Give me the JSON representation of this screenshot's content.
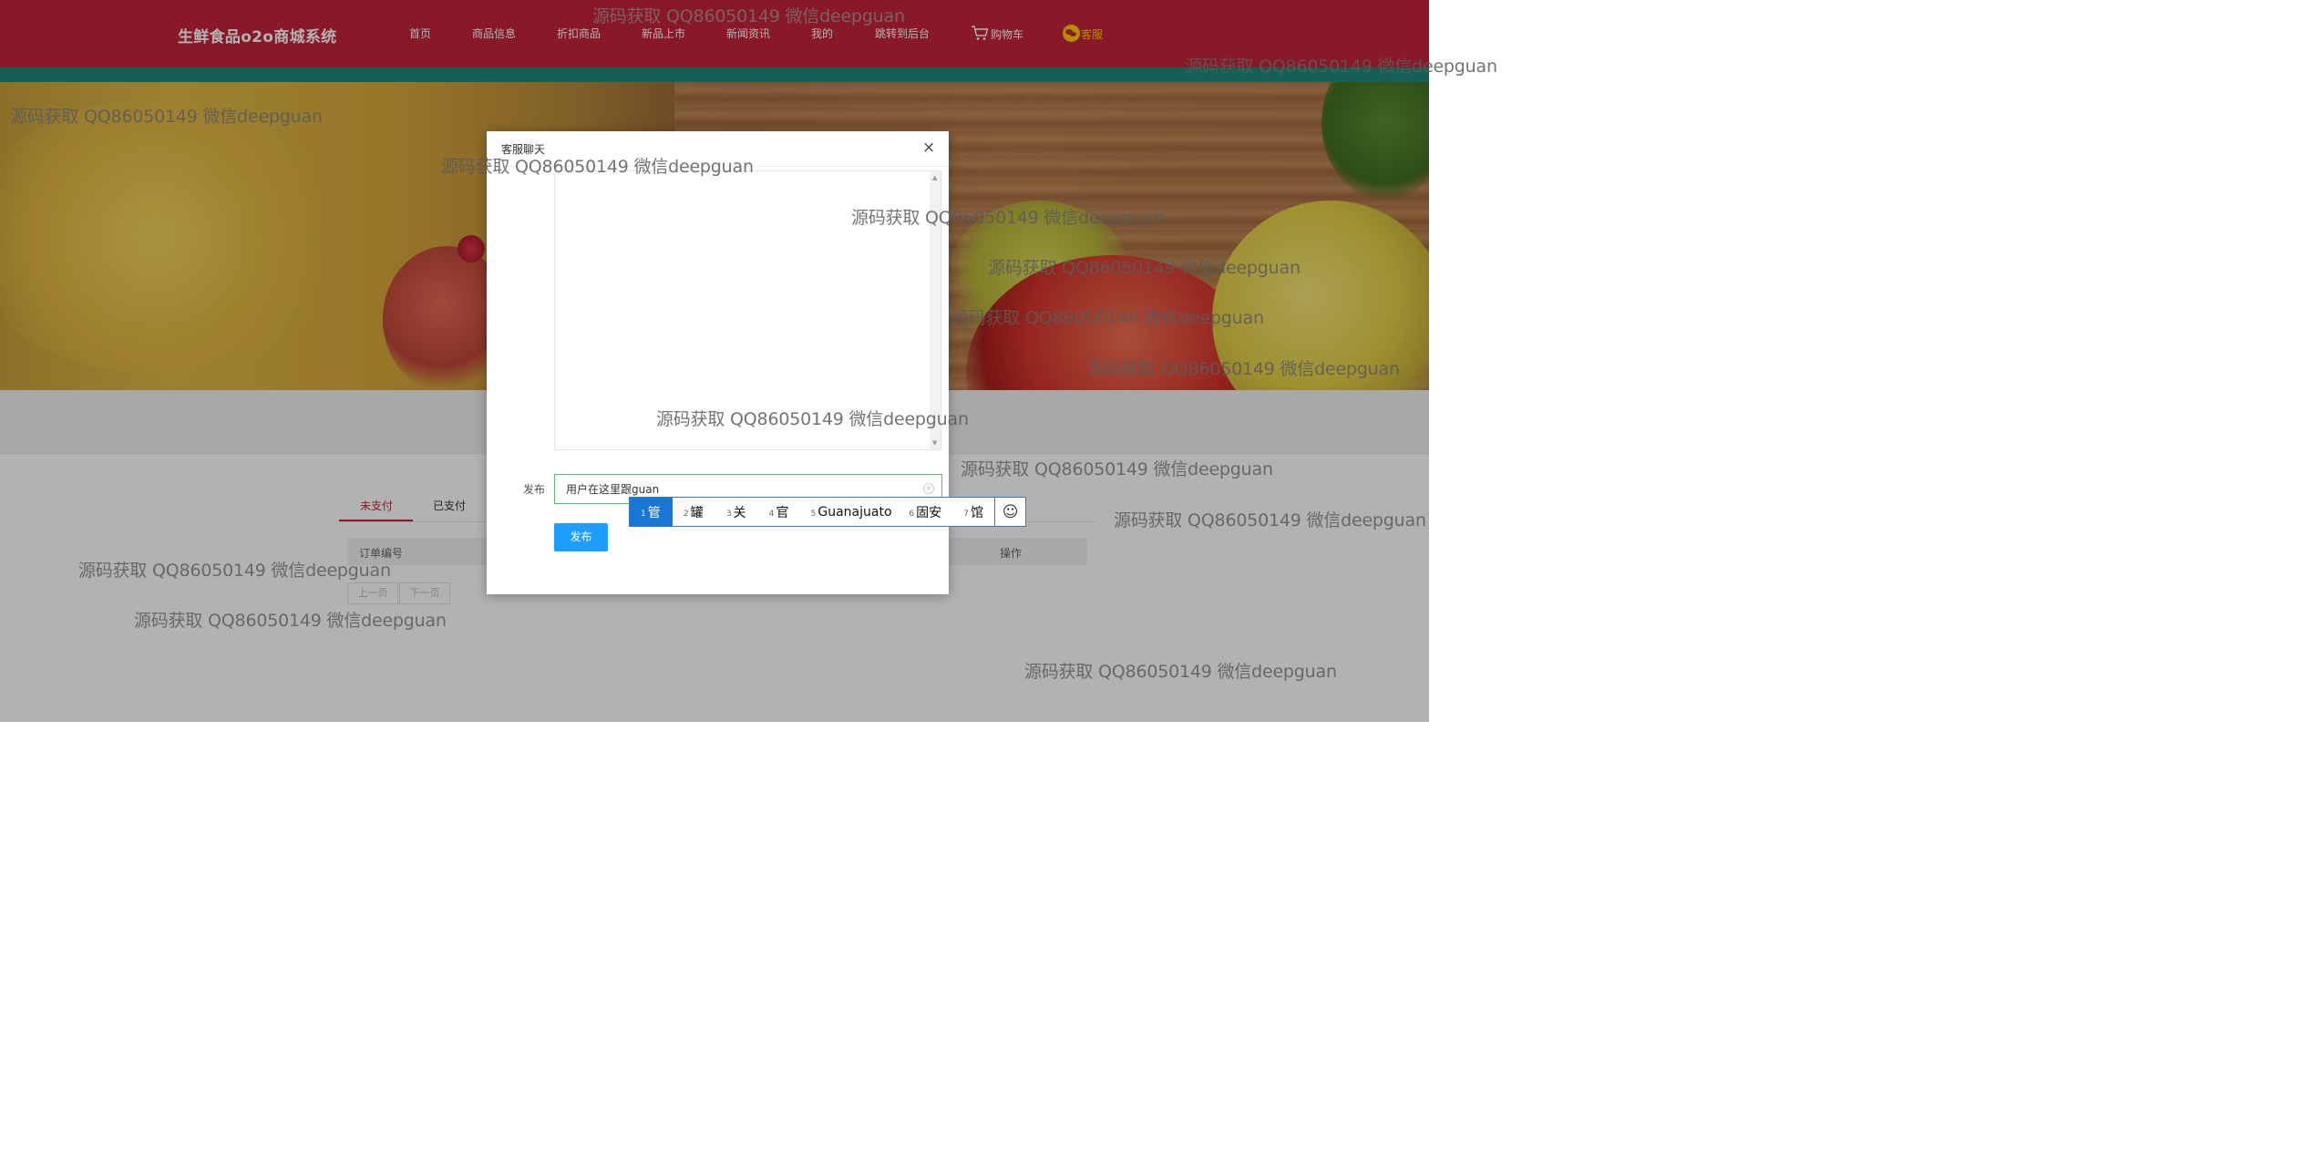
{
  "header": {
    "brand": "生鲜食品o2o商城系统",
    "nav": [
      "首页",
      "商品信息",
      "折扣商品",
      "新品上市",
      "新闻资讯",
      "我的",
      "跳转到后台"
    ],
    "cart_label": "购物车",
    "service_label": "客服"
  },
  "orders": {
    "tabs": [
      "未支付",
      "已支付"
    ],
    "columns": [
      "订单编号",
      "操作"
    ],
    "pagination": {
      "prev": "上一页",
      "next": "下一页"
    }
  },
  "modal": {
    "title": "客服聊天",
    "close": "×",
    "post_label": "发布",
    "input_value": "用户在这里跟guan",
    "submit": "发布"
  },
  "ime": {
    "candidates": [
      {
        "num": "1",
        "text": "管"
      },
      {
        "num": "2",
        "text": "罐"
      },
      {
        "num": "3",
        "text": "关"
      },
      {
        "num": "4",
        "text": "官"
      },
      {
        "num": "5",
        "text": "Guanajuato"
      },
      {
        "num": "6",
        "text": "固安"
      },
      {
        "num": "7",
        "text": "馆"
      }
    ],
    "emoji": "☺"
  },
  "watermark": "源码获取 QQ86050149 微信deepguan",
  "colors": {
    "header": "#c4253a",
    "teal": "#1c8a7d",
    "primary_button": "#1e9fff",
    "ime_select": "#1976d2"
  }
}
